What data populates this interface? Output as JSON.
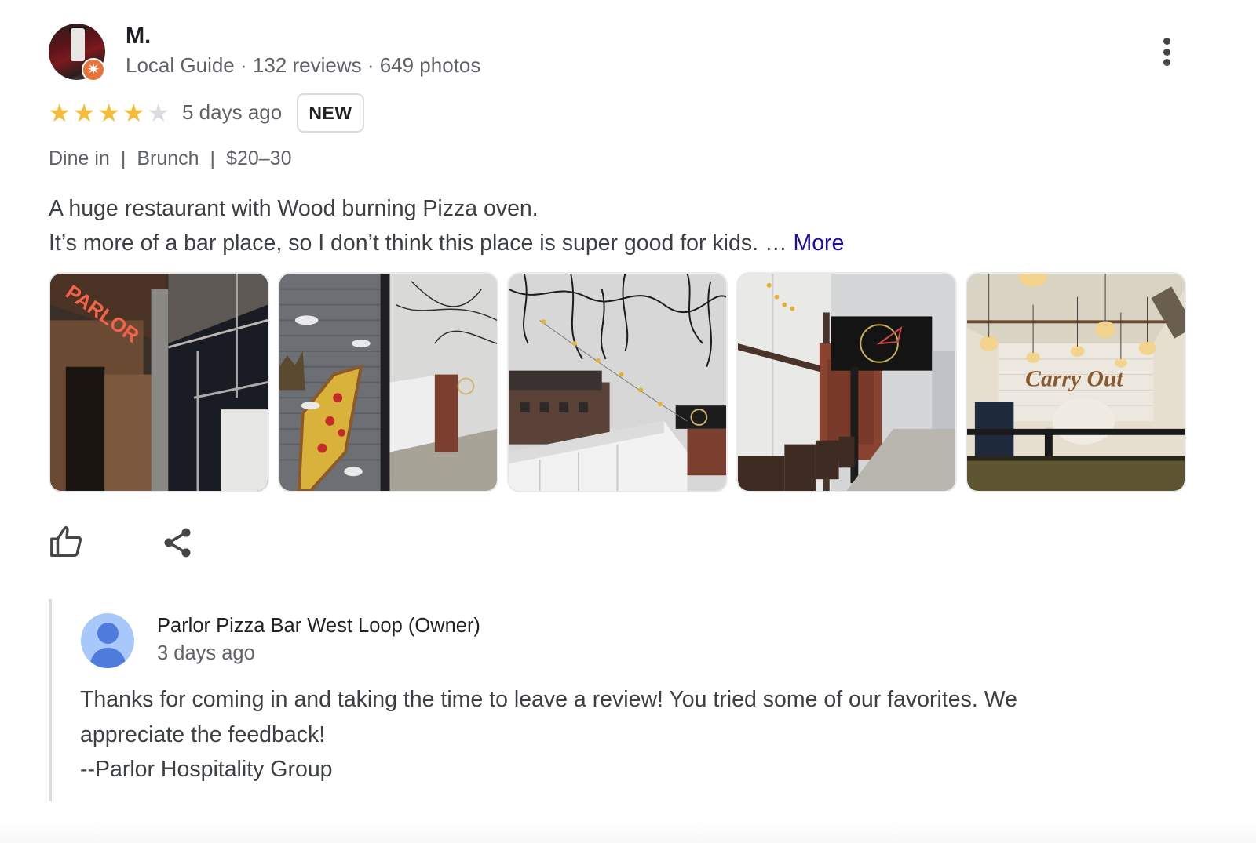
{
  "review": {
    "author": {
      "name": "M.",
      "meta": "Local Guide · 132 reviews · 649 photos",
      "avatar_icon": "profile-photo",
      "badge_icon": "local-guide-star-icon"
    },
    "menu_icon": "more-vert-icon",
    "rating": {
      "value": 4,
      "max": 5,
      "star_glyph": "★"
    },
    "date": "5 days ago",
    "badge": "NEW",
    "attributes": [
      "Dine in",
      "Brunch",
      "$20–30"
    ],
    "attribute_separator": "|",
    "text_lines": [
      "A huge restaurant with Wood burning Pizza oven.",
      "It’s more of a bar place, so I don’t think this place is super good for kids. …"
    ],
    "more_label": "More",
    "more_color": "#1a0dab",
    "photos": [
      {
        "alt": "Parlor neon sign at entrance"
      },
      {
        "alt": "Pizza mural on garage door and sidewalk"
      },
      {
        "alt": "Bare tree branches over white tent"
      },
      {
        "alt": "Pizza logo sign and brick building"
      },
      {
        "alt": "Carry Out interior with pendant lights"
      }
    ],
    "actions": {
      "like_icon": "thumb-up-icon",
      "share_icon": "share-icon"
    }
  },
  "owner_response": {
    "name": "Parlor Pizza Bar West Loop (Owner)",
    "date": "3 days ago",
    "avatar_icon": "default-person-icon",
    "text_lines": [
      "Thanks for coming in and taking the time to leave a review! You tried some of our favorites. We",
      "appreciate the feedback!",
      "--Parlor Hospitality Group"
    ]
  },
  "colors": {
    "star_on": "#f4bc38",
    "star_off": "#dadce0",
    "guide_badge": "#e8743b",
    "owner_avatar_bg": "#a8c7fa",
    "owner_avatar_fg": "#4f7bdc"
  }
}
